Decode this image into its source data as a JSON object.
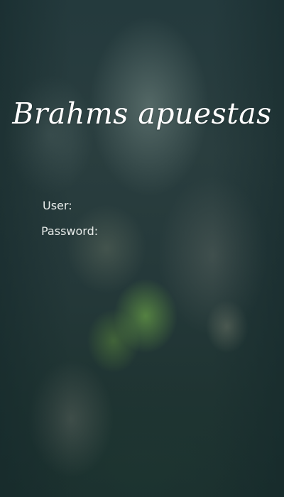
{
  "app": {
    "title": "Brahms apuestas"
  },
  "login": {
    "user_label": "User:",
    "user_value": "",
    "password_label": "Password:",
    "password_value": ""
  },
  "colors": {
    "background": "#1f3437",
    "text": "#ffffff",
    "accent_green": "#69a046"
  }
}
